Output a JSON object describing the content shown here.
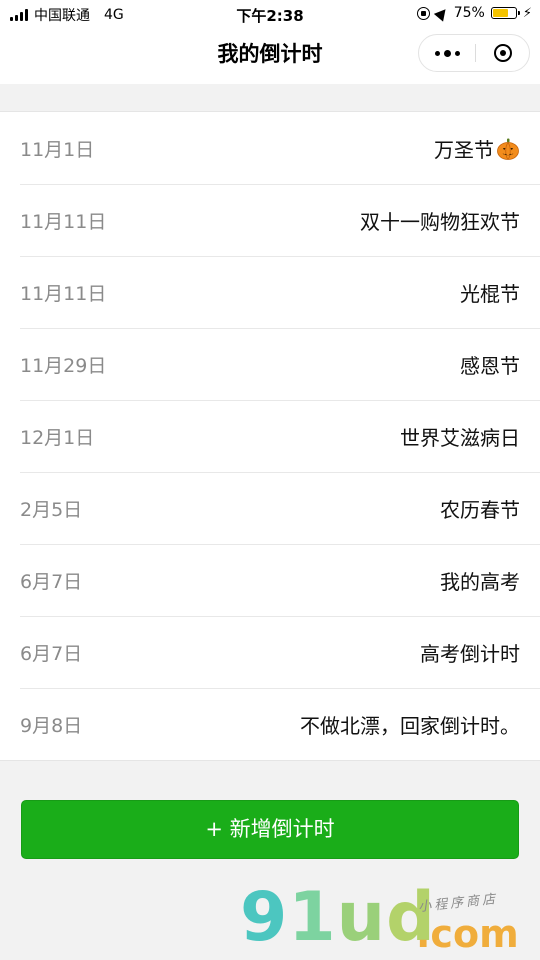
{
  "status_bar": {
    "carrier": "中国联通",
    "network": "4G",
    "time": "下午2:38",
    "battery": "75%",
    "battery_level": 0.75,
    "battery_color": "#f5c400"
  },
  "nav": {
    "title": "我的倒计时",
    "more_icon": "more-dots-icon",
    "close_icon": "target-ring-icon"
  },
  "countdowns": [
    {
      "date": "11月1日",
      "name": "万圣节",
      "icon": "pumpkin-icon"
    },
    {
      "date": "11月11日",
      "name": "双十一购物狂欢节"
    },
    {
      "date": "11月11日",
      "name": "光棍节"
    },
    {
      "date": "11月29日",
      "name": "感恩节"
    },
    {
      "date": "12月1日",
      "name": "世界艾滋病日"
    },
    {
      "date": "2月5日",
      "name": "农历春节"
    },
    {
      "date": "6月7日",
      "name": "我的高考"
    },
    {
      "date": "6月7日",
      "name": "高考倒计时"
    },
    {
      "date": "9月8日",
      "name": "不做北漂，回家倒计时。"
    }
  ],
  "add_button": {
    "label": "+ 新增倒计时",
    "color": "#1aad19"
  },
  "watermark": {
    "logo_text": "91ud",
    "domain_text": ".com",
    "tagline": "小程序商店"
  }
}
